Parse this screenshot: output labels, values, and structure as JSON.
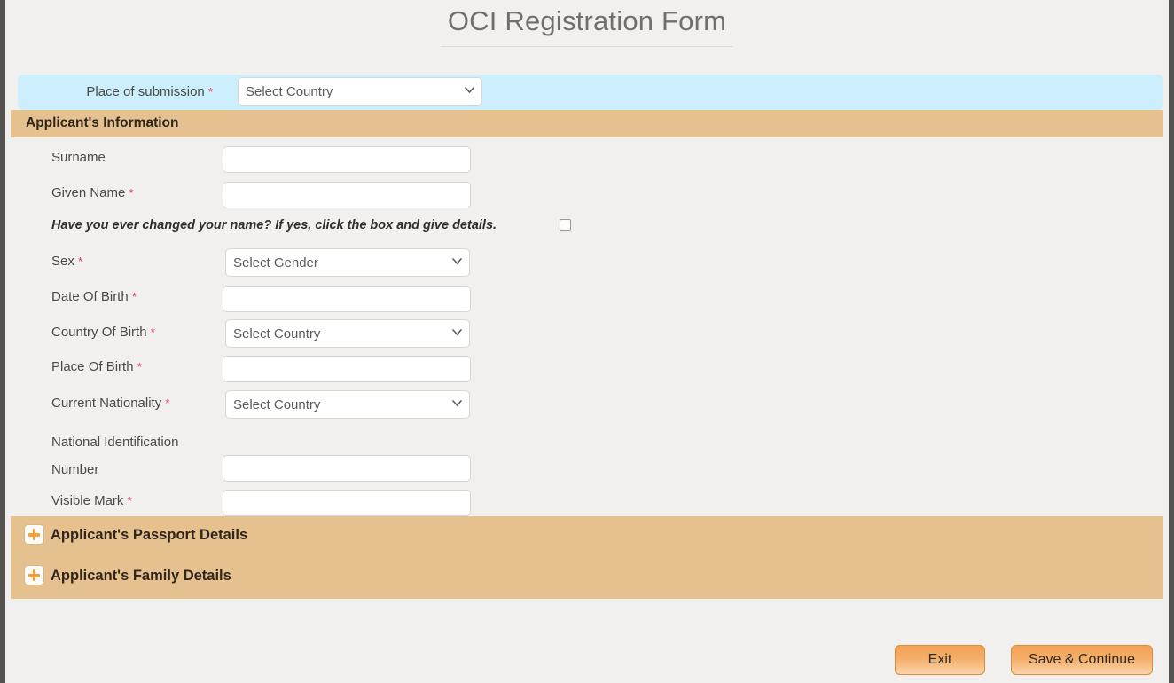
{
  "header": {
    "title": "OCI Registration Form"
  },
  "submission": {
    "label": "Place of submission",
    "required_marker": "*",
    "select_value": "Select Country",
    "options": [
      "Select Country"
    ]
  },
  "applicant_section": {
    "heading": "Applicant's Information",
    "fields": [
      {
        "label": "Surname",
        "required_marker": "",
        "type": "text",
        "value": "",
        "placeholder": ""
      },
      {
        "label": "Given Name",
        "required_marker": "*",
        "type": "text",
        "value": "",
        "placeholder": ""
      },
      {
        "label": "Sex",
        "required_marker": "*",
        "type": "select",
        "value": "Select Gender",
        "options": [
          "Select Gender"
        ]
      },
      {
        "label": "Date Of Birth",
        "required_marker": "*",
        "type": "text",
        "value": "",
        "placeholder": ""
      },
      {
        "label": "Country Of Birth",
        "required_marker": "*",
        "type": "select",
        "value": "Select Country",
        "options": [
          "Select Country"
        ]
      },
      {
        "label": "Place Of Birth",
        "required_marker": "*",
        "type": "text",
        "value": "",
        "placeholder": ""
      },
      {
        "label": "Current Nationality",
        "required_marker": "*",
        "type": "select",
        "value": "Select Country",
        "options": [
          "Select Country"
        ]
      },
      {
        "label": "National Identification Number",
        "required_marker": "",
        "type": "text",
        "value": "",
        "placeholder": ""
      },
      {
        "label": "Visible Mark",
        "required_marker": "*",
        "type": "text",
        "value": "",
        "placeholder": ""
      }
    ],
    "name_change_question": "Have you ever changed your name? If yes, click the box and give details.",
    "name_change_checked": false
  },
  "accordion": {
    "items": [
      {
        "label": "Applicant's Passport Details",
        "icon": "plus-icon",
        "expanded": false
      },
      {
        "label": "Applicant's Family Details",
        "icon": "plus-icon",
        "expanded": false
      }
    ]
  },
  "footer": {
    "exit_label": "Exit",
    "save_label": "Save & Continue"
  },
  "colors": {
    "page_background": "#f1f0ee",
    "submission_band": "#cdeefc",
    "section_bar": "#e6c190",
    "accent_orange": "#f2a03c",
    "required_red": "#e0365a",
    "title_text": "#706f6d",
    "heading_text": "#30251a"
  }
}
